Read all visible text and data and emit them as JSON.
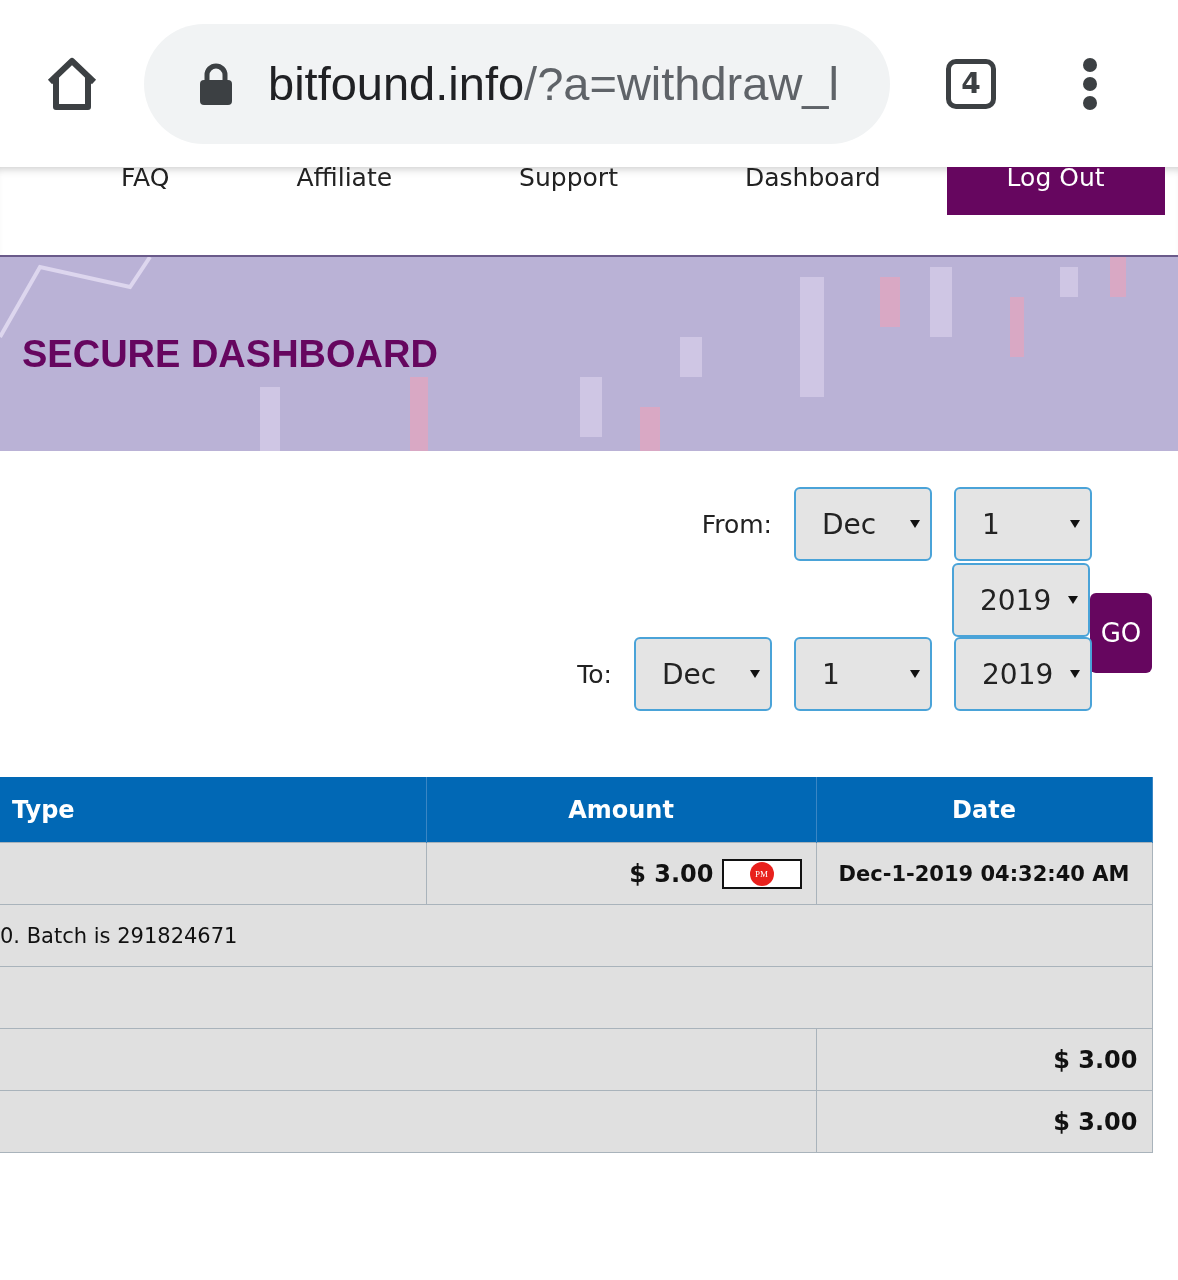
{
  "browser": {
    "url_host": "bitfound.info",
    "url_path": "/?a=withdraw_l",
    "tab_count": "4"
  },
  "nav": {
    "items": [
      {
        "label": "FAQ",
        "kind": "link"
      },
      {
        "label": "Affiliate",
        "kind": "link"
      },
      {
        "label": "Support",
        "kind": "link"
      },
      {
        "label": "Dashboard",
        "kind": "link"
      },
      {
        "label": "Log Out",
        "kind": "button"
      }
    ]
  },
  "banner": {
    "title": "SECURE DASHBOARD"
  },
  "filter": {
    "from_label": "From:",
    "from": {
      "month": "Dec",
      "day": "1",
      "year": "2019"
    },
    "to_label": "To:",
    "to": {
      "month": "Dec",
      "day": "1",
      "year": "2019"
    },
    "go": "GO"
  },
  "table": {
    "columns": [
      "Type",
      "Amount",
      "Date"
    ],
    "rows": [
      {
        "kind": "entry",
        "type": "",
        "amount": "$ 3.00",
        "badge": "PM",
        "date": "Dec-1-2019 04:32:40 AM"
      },
      {
        "kind": "note",
        "text": "0. Batch is 291824671"
      },
      {
        "kind": "blank"
      },
      {
        "kind": "total",
        "value": "$ 3.00"
      },
      {
        "kind": "total",
        "value": "$ 3.00"
      }
    ]
  }
}
